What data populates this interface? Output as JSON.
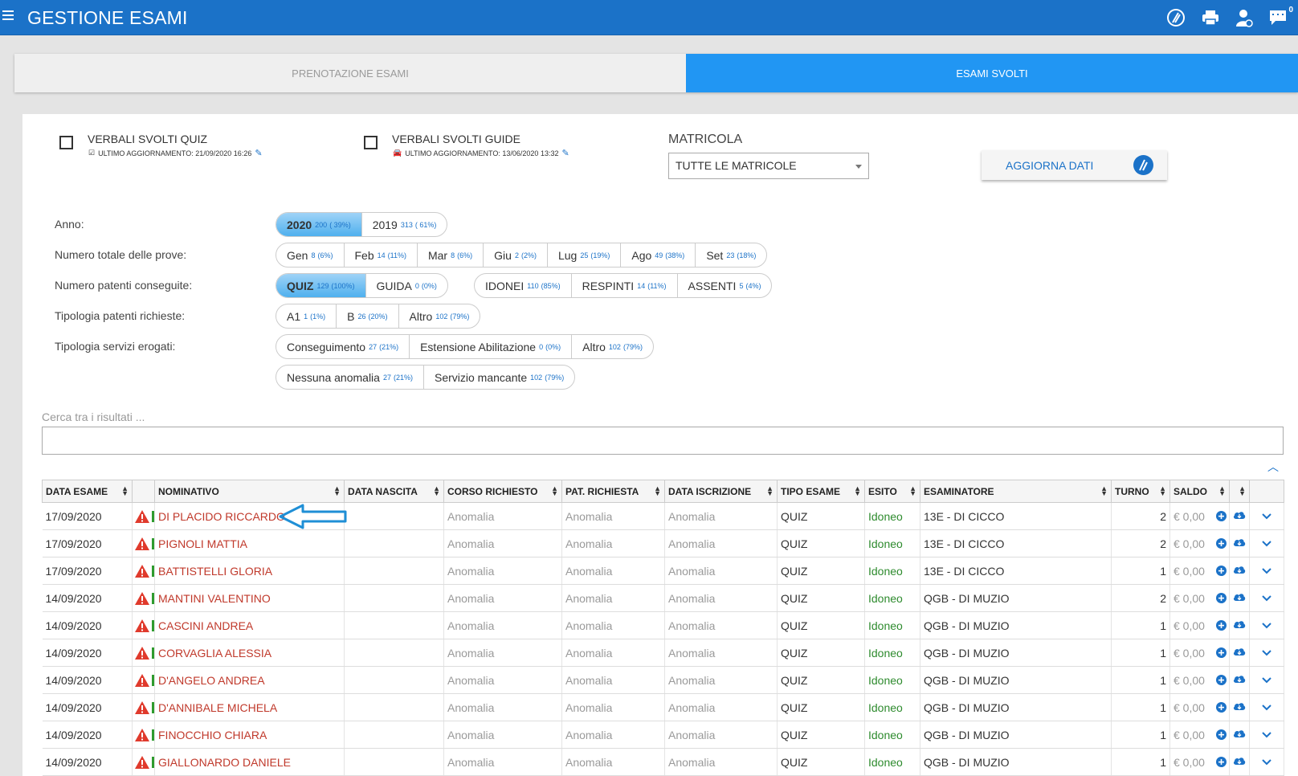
{
  "header": {
    "title": "GESTIONE ESAMI",
    "messages_badge": "0"
  },
  "tabs": [
    {
      "label": "PRENOTAZIONE ESAMI"
    },
    {
      "label": "ESAMI SVOLTI"
    }
  ],
  "verbali": {
    "quiz_title": "VERBALI SVOLTI QUIZ",
    "quiz_updated": "ULTIMO AGGIORNAMENTO: 21/09/2020 16:26",
    "guide_title": "VERBALI SVOLTI GUIDE",
    "guide_updated": "ULTIMO AGGIORNAMENTO: 13/06/2020 13:32"
  },
  "matricola": {
    "label": "MATRICOLA",
    "selected": "TUTTE LE MATRICOLE"
  },
  "aggiorna_label": "AGGIORNA DATI",
  "filters": {
    "anno_label": "Anno:",
    "anno": [
      {
        "label": "2020",
        "n": "200",
        "p": "( 39%)"
      },
      {
        "label": "2019",
        "n": "313",
        "p": "( 61%)"
      }
    ],
    "prove_label": "Numero totale delle prove:",
    "prove": [
      {
        "label": "Gen",
        "n": "8",
        "p": "(6%)"
      },
      {
        "label": "Feb",
        "n": "14",
        "p": "(11%)"
      },
      {
        "label": "Mar",
        "n": "8",
        "p": "(6%)"
      },
      {
        "label": "Giu",
        "n": "2",
        "p": "(2%)"
      },
      {
        "label": "Lug",
        "n": "25",
        "p": "(19%)"
      },
      {
        "label": "Ago",
        "n": "49",
        "p": "(38%)"
      },
      {
        "label": "Set",
        "n": "23",
        "p": "(18%)"
      }
    ],
    "patenti_label": "Numero patenti conseguite:",
    "patenti_a": [
      {
        "label": "QUIZ",
        "n": "129",
        "p": "(100%)"
      },
      {
        "label": "GUIDA",
        "n": "0",
        "p": "(0%)"
      }
    ],
    "patenti_b": [
      {
        "label": "IDONEI",
        "n": "110",
        "p": "(85%)"
      },
      {
        "label": "RESPINTI",
        "n": "14",
        "p": "(11%)"
      },
      {
        "label": "ASSENTI",
        "n": "5",
        "p": "(4%)"
      }
    ],
    "tipologia_label": "Tipologia patenti richieste:",
    "tipologia": [
      {
        "label": "A1",
        "n": "1",
        "p": "(1%)"
      },
      {
        "label": "B",
        "n": "26",
        "p": "(20%)"
      },
      {
        "label": "Altro",
        "n": "102",
        "p": "(79%)"
      }
    ],
    "servizi_label": "Tipologia servizi erogati:",
    "servizi_a": [
      {
        "label": "Conseguimento",
        "n": "27",
        "p": "(21%)"
      },
      {
        "label": "Estensione Abilitazione",
        "n": "0",
        "p": "(0%)"
      },
      {
        "label": "Altro",
        "n": "102",
        "p": "(79%)"
      }
    ],
    "servizi_b": [
      {
        "label": "Nessuna anomalia",
        "n": "27",
        "p": "(21%)"
      },
      {
        "label": "Servizio mancante",
        "n": "102",
        "p": "(79%)"
      }
    ]
  },
  "search": {
    "label": "Cerca tra i risultati ..."
  },
  "table": {
    "columns": [
      "DATA ESAME",
      "",
      "NOMINATIVO",
      "DATA NASCITA",
      "CORSO RICHIESTO",
      "PAT. RICHIESTA",
      "DATA ISCRIZIONE",
      "TIPO ESAME",
      "ESITO",
      "ESAMINATORE",
      "TURNO",
      "SALDO",
      "",
      ""
    ],
    "rows": [
      {
        "data": "17/09/2020",
        "nome": "DI PLACIDO RICCARDO",
        "nascita": "",
        "corso": "Anomalia",
        "pat": "Anomalia",
        "iscr": "Anomalia",
        "tipo": "QUIZ",
        "esito": "Idoneo",
        "esam": "13E - DI CICCO",
        "turno": "2",
        "saldo": "€ 0,00"
      },
      {
        "data": "17/09/2020",
        "nome": "PIGNOLI MATTIA",
        "nascita": "",
        "corso": "Anomalia",
        "pat": "Anomalia",
        "iscr": "Anomalia",
        "tipo": "QUIZ",
        "esito": "Idoneo",
        "esam": "13E - DI CICCO",
        "turno": "2",
        "saldo": "€ 0,00"
      },
      {
        "data": "17/09/2020",
        "nome": "BATTISTELLI GLORIA",
        "nascita": "",
        "corso": "Anomalia",
        "pat": "Anomalia",
        "iscr": "Anomalia",
        "tipo": "QUIZ",
        "esito": "Idoneo",
        "esam": "13E - DI CICCO",
        "turno": "1",
        "saldo": "€ 0,00"
      },
      {
        "data": "14/09/2020",
        "nome": "MANTINI VALENTINO",
        "nascita": "",
        "corso": "Anomalia",
        "pat": "Anomalia",
        "iscr": "Anomalia",
        "tipo": "QUIZ",
        "esito": "Idoneo",
        "esam": "QGB - DI MUZIO",
        "turno": "2",
        "saldo": "€ 0,00"
      },
      {
        "data": "14/09/2020",
        "nome": "CASCINI ANDREA",
        "nascita": "",
        "corso": "Anomalia",
        "pat": "Anomalia",
        "iscr": "Anomalia",
        "tipo": "QUIZ",
        "esito": "Idoneo",
        "esam": "QGB - DI MUZIO",
        "turno": "1",
        "saldo": "€ 0,00"
      },
      {
        "data": "14/09/2020",
        "nome": "CORVAGLIA ALESSIA",
        "nascita": "",
        "corso": "Anomalia",
        "pat": "Anomalia",
        "iscr": "Anomalia",
        "tipo": "QUIZ",
        "esito": "Idoneo",
        "esam": "QGB - DI MUZIO",
        "turno": "1",
        "saldo": "€ 0,00"
      },
      {
        "data": "14/09/2020",
        "nome": "D'ANGELO ANDREA",
        "nascita": "",
        "corso": "Anomalia",
        "pat": "Anomalia",
        "iscr": "Anomalia",
        "tipo": "QUIZ",
        "esito": "Idoneo",
        "esam": "QGB - DI MUZIO",
        "turno": "1",
        "saldo": "€ 0,00"
      },
      {
        "data": "14/09/2020",
        "nome": "D'ANNIBALE MICHELA",
        "nascita": "",
        "corso": "Anomalia",
        "pat": "Anomalia",
        "iscr": "Anomalia",
        "tipo": "QUIZ",
        "esito": "Idoneo",
        "esam": "QGB - DI MUZIO",
        "turno": "1",
        "saldo": "€ 0,00"
      },
      {
        "data": "14/09/2020",
        "nome": "FINOCCHIO CHIARA",
        "nascita": "",
        "corso": "Anomalia",
        "pat": "Anomalia",
        "iscr": "Anomalia",
        "tipo": "QUIZ",
        "esito": "Idoneo",
        "esam": "QGB - DI MUZIO",
        "turno": "1",
        "saldo": "€ 0,00"
      },
      {
        "data": "14/09/2020",
        "nome": "GIALLONARDO DANIELE",
        "nascita": "",
        "corso": "Anomalia",
        "pat": "Anomalia",
        "iscr": "Anomalia",
        "tipo": "QUIZ",
        "esito": "Idoneo",
        "esam": "QGB - DI MUZIO",
        "turno": "1",
        "saldo": "€ 0,00"
      }
    ]
  }
}
